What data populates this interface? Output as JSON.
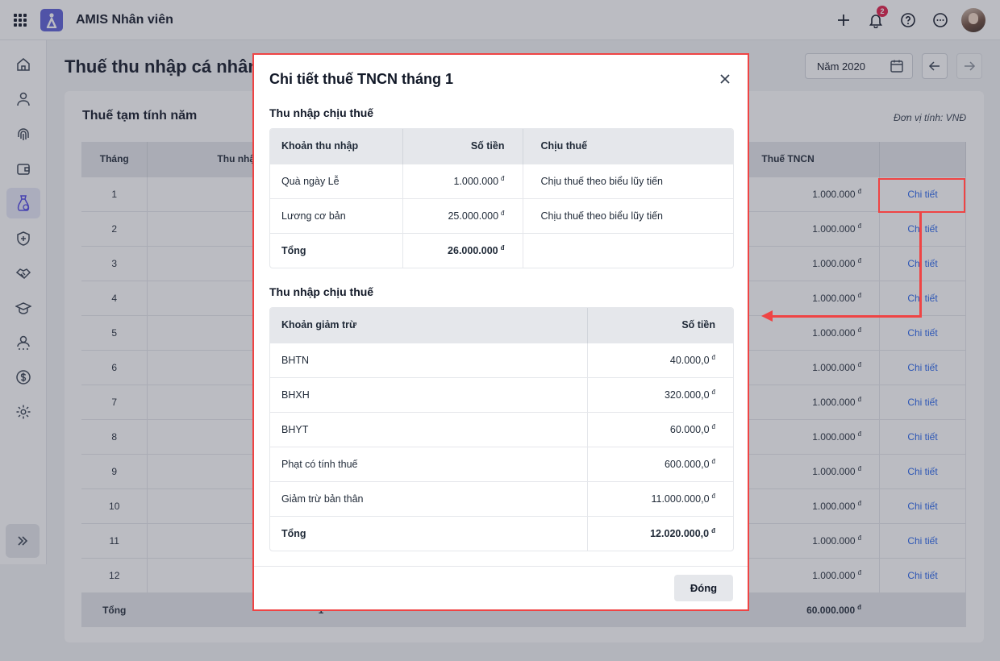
{
  "app": {
    "title": "AMIS Nhân viên",
    "notification_count": "2"
  },
  "page": {
    "title": "Thuế thu nhập cá nhân",
    "year_label": "Năm 2020",
    "card_title": "Thuế tạm tính năm",
    "unit_note": "Đơn vị tính: VNĐ"
  },
  "bg_table": {
    "headers": {
      "month": "Tháng",
      "income": "Thu nhập",
      "tax": "Thuế TNCN"
    },
    "rows": [
      {
        "month": "1",
        "tax": "1.000.000",
        "link": "Chi tiết"
      },
      {
        "month": "2",
        "tax": "1.000.000",
        "link": "Chi tiết"
      },
      {
        "month": "3",
        "tax": "1.000.000",
        "link": "Chi tiết"
      },
      {
        "month": "4",
        "tax": "1.000.000",
        "link": "Chi tiết"
      },
      {
        "month": "5",
        "tax": "1.000.000",
        "link": "Chi tiết"
      },
      {
        "month": "6",
        "tax": "1.000.000",
        "link": "Chi tiết"
      },
      {
        "month": "7",
        "tax": "1.000.000",
        "link": "Chi tiết"
      },
      {
        "month": "8",
        "tax": "1.000.000",
        "link": "Chi tiết"
      },
      {
        "month": "9",
        "tax": "1.000.000",
        "link": "Chi tiết"
      },
      {
        "month": "10",
        "tax": "1.000.000",
        "link": "Chi tiết"
      },
      {
        "month": "11",
        "tax": "1.000.000",
        "link": "Chi tiết"
      },
      {
        "month": "12",
        "tax": "1.000.000",
        "link": "Chi tiết"
      }
    ],
    "total": {
      "label": "Tổng",
      "income_partial": "1",
      "tax": "60.000.000"
    }
  },
  "modal": {
    "title": "Chi tiết thuế TNCN tháng 1",
    "currency_symbol": "đ",
    "income_section": {
      "title": "Thu nhập chịu thuế",
      "headers": {
        "item": "Khoản thu nhập",
        "amount": "Số tiền",
        "tax_type": "Chịu thuế"
      },
      "rows": [
        {
          "item": "Quà ngày Lễ",
          "amount": "1.000.000",
          "tax_type": "Chịu thuế theo biểu lũy tiến"
        },
        {
          "item": "Lương cơ bản",
          "amount": "25.000.000",
          "tax_type": "Chịu thuế theo biểu lũy tiến"
        }
      ],
      "total": {
        "label": "Tổng",
        "amount": "26.000.000"
      }
    },
    "deduction_section": {
      "title": "Thu nhập chịu thuế",
      "headers": {
        "item": "Khoản giảm trừ",
        "amount": "Số tiền"
      },
      "rows": [
        {
          "item": "BHTN",
          "amount": "40.000,0"
        },
        {
          "item": "BHXH",
          "amount": "320.000,0"
        },
        {
          "item": "BHYT",
          "amount": "60.000,0"
        },
        {
          "item": "Phạt có tính thuế",
          "amount": "600.000,0"
        },
        {
          "item": "Giảm trừ bản thân",
          "amount": "11.000.000,0"
        }
      ],
      "total": {
        "label": "Tổng",
        "amount": "12.020.000,0"
      }
    },
    "close_label": "Đóng"
  },
  "colors": {
    "accent": "#5b5fd6",
    "highlight": "#ef4444",
    "link": "#2563eb"
  }
}
